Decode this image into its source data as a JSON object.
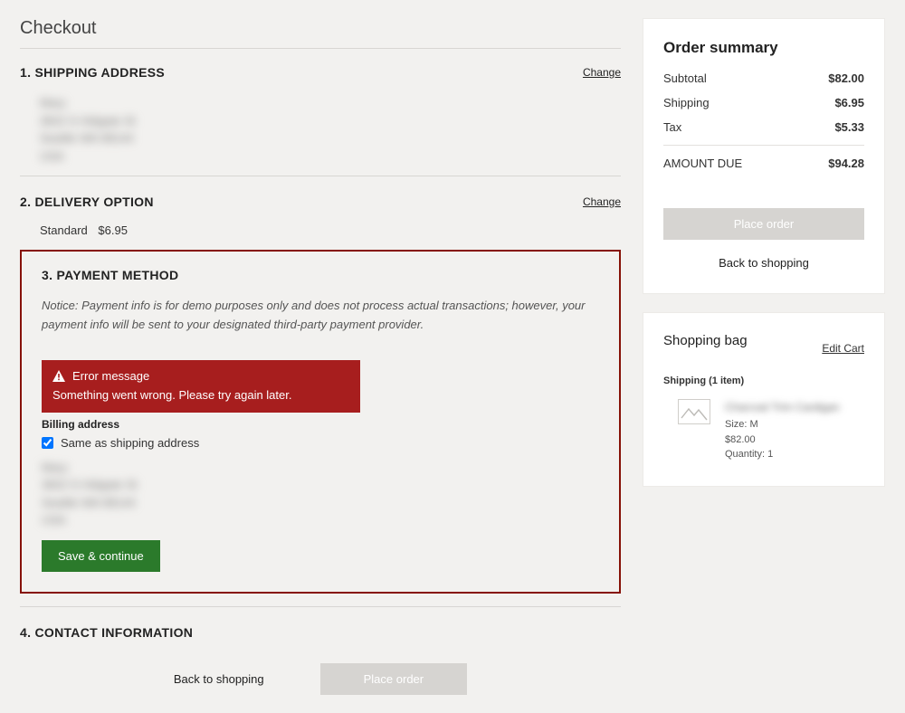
{
  "pageTitle": "Checkout",
  "steps": {
    "shipping": {
      "num": "1.",
      "title": "SHIPPING ADDRESS",
      "change": "Change",
      "address": "Mary\n3822 S Hidgate St\nSeattle WA  98144\nUSA"
    },
    "delivery": {
      "num": "2.",
      "title": "DELIVERY OPTION",
      "change": "Change",
      "option": "Standard",
      "price": "$6.95"
    },
    "payment": {
      "num": "3.",
      "title": "PAYMENT METHOD",
      "notice": "Notice: Payment info is for demo purposes only and does not process actual transactions; however, your payment info will be sent to your designated third-party payment provider.",
      "errorTitle": "Error message",
      "errorBody": "Something went wrong. Please try again later.",
      "billingLabel": "Billing address",
      "sameAs": "Same as shipping address",
      "billingAddress": "Mary\n3822 S Hidgate St\nSeattle WA  98144\nUSA",
      "saveBtn": "Save & continue"
    },
    "contact": {
      "num": "4.",
      "title": "CONTACT INFORMATION"
    }
  },
  "actions": {
    "back": "Back to shopping",
    "placeOrder": "Place order"
  },
  "summary": {
    "title": "Order summary",
    "subtotalLabel": "Subtotal",
    "subtotal": "$82.00",
    "shippingLabel": "Shipping",
    "shipping": "$6.95",
    "taxLabel": "Tax",
    "tax": "$5.33",
    "dueLabel": "AMOUNT DUE",
    "due": "$94.28"
  },
  "bag": {
    "title": "Shopping bag",
    "edit": "Edit Cart",
    "shipLabel": "Shipping (1 item)",
    "item": {
      "name": "Charcoal Trim Cardigan",
      "size": "Size: M",
      "price": "$82.00",
      "qty": "Quantity: 1"
    }
  }
}
